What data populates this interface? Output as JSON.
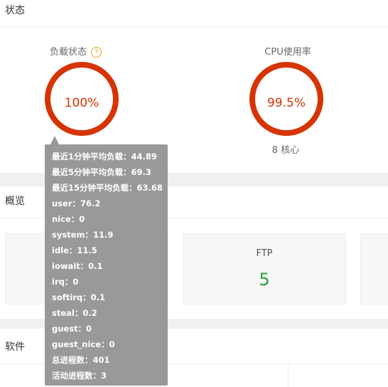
{
  "status": {
    "title": "状态",
    "load": {
      "title": "负载状态",
      "value": "100%",
      "help": "?"
    },
    "cpu": {
      "title": "CPU使用率",
      "value": "99.5%",
      "cores": "8 核心"
    }
  },
  "overview": {
    "title": "概览",
    "ftp": {
      "label": "FTP",
      "value": "5"
    }
  },
  "software": {
    "title": "软件"
  },
  "tooltip": [
    "最近1分钟平均负载：44.89",
    "最近5分钟平均负载：69.3",
    "最近15分钟平均负载：63.68",
    "user：76.2",
    "nice：0",
    "system：11.9",
    "idle：11.5",
    "iowait：0.1",
    "irq：0",
    "softirq：0.1",
    "steal：0.2",
    "guest：0",
    "guest_nice：0",
    "总进程数：401",
    "活动进程数：3"
  ],
  "colors": {
    "gauge": "#d63404",
    "ftp_value": "#20a53a",
    "help": "#f0a020"
  }
}
